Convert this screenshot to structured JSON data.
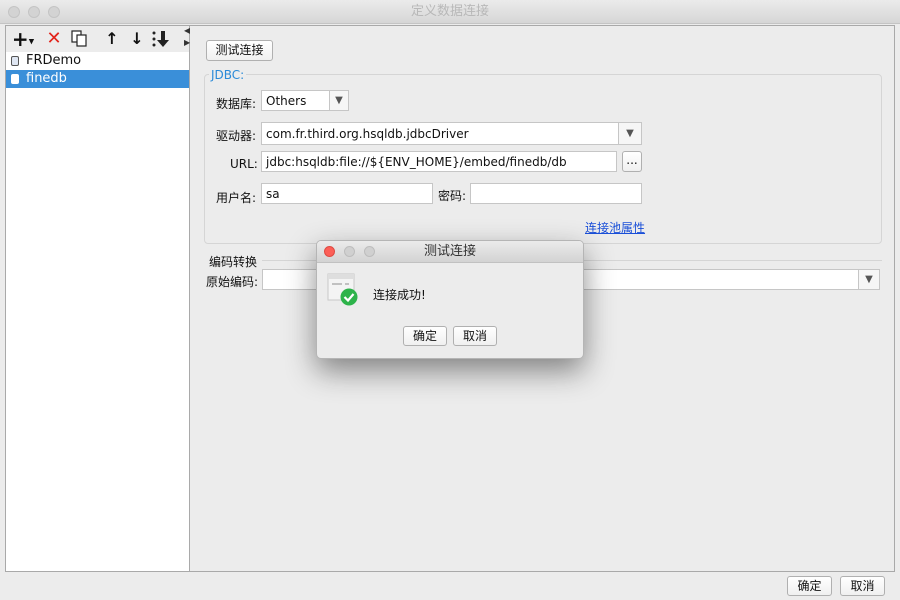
{
  "window": {
    "title": "定义数据连接"
  },
  "toolbar": {
    "icons": [
      "plus-icon",
      "delete-icon",
      "copy-icon",
      "arrow-up-icon",
      "arrow-down-icon",
      "sort-icon"
    ]
  },
  "connections": [
    {
      "name": "FRDemo",
      "selected": false
    },
    {
      "name": "finedb",
      "selected": true
    }
  ],
  "form": {
    "test_button": "测试连接",
    "jdbc_legend": "JDBC:",
    "database_label": "数据库:",
    "database_value": "Others",
    "driver_label": "驱动器:",
    "driver_value": "com.fr.third.org.hsqldb.jdbcDriver",
    "url_label": "URL:",
    "url_value": "jdbc:hsqldb:file://${ENV_HOME}/embed/finedb/db",
    "url_browse": "...",
    "username_label": "用户名:",
    "username_value": "sa",
    "password_label": "密码:",
    "password_value": "",
    "pool_link": "连接池属性",
    "encoding_legend": "编码转换",
    "encoding_label": "原始编码:",
    "encoding_value": ""
  },
  "dialog": {
    "title": "测试连接",
    "message": "连接成功!",
    "ok_button": "确定",
    "cancel_button": "取消"
  },
  "footer": {
    "ok_button": "确定",
    "cancel_button": "取消"
  },
  "colors": {
    "selection": "#3a8fd9",
    "link": "#1a4fd8",
    "jdbc_legend": "#2a8ad8",
    "success": "#2db34a",
    "close_red": "#fc5f57"
  }
}
